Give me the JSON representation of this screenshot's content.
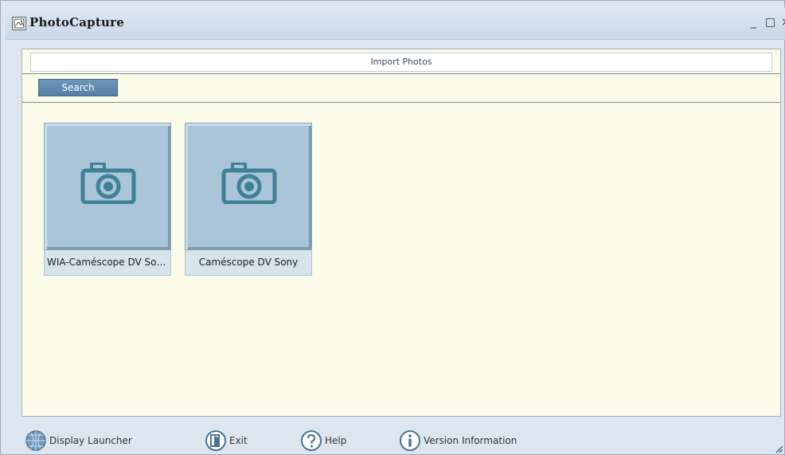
{
  "window": {
    "title": "PhotoCapture",
    "controls": {
      "minimize": "_",
      "maximize": "□",
      "close": "×"
    }
  },
  "panel": {
    "header": "Import Photos",
    "search_label": "Search"
  },
  "devices": [
    {
      "label": "WIA-Caméscope DV Sony",
      "icon": "camera-icon"
    },
    {
      "label": "Caméscope DV Sony",
      "icon": "camera-icon"
    }
  ],
  "footer": {
    "display_launcher": "Display Launcher",
    "exit": "Exit",
    "help": "Help",
    "version_info": "Version Information"
  },
  "colors": {
    "window_bg": "#dde6ee",
    "content_bg": "#fbfbe9",
    "tile_bg": "#a9c5d7",
    "accent": "#547fa6",
    "icon_teal": "#3f8197"
  }
}
